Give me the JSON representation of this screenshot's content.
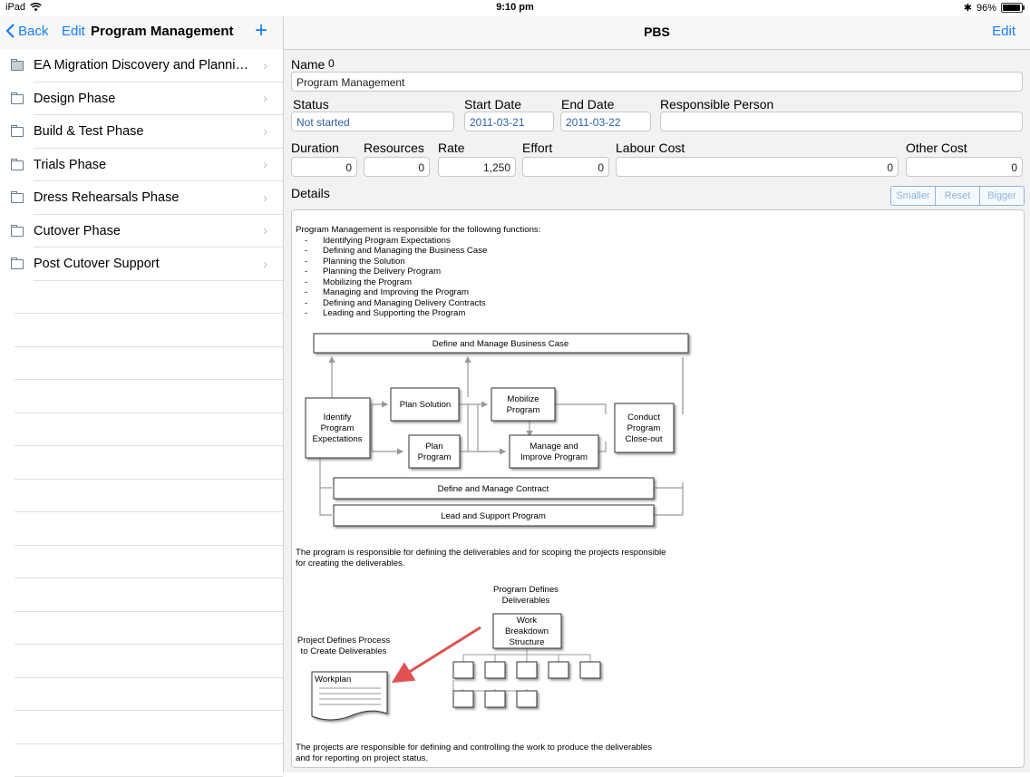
{
  "status_bar": {
    "device": "iPad",
    "time": "9:10 pm",
    "battery": "96%"
  },
  "sidebar": {
    "back_label": "Back",
    "edit_label": "Edit",
    "title": "Program Management",
    "add_label": "+",
    "items": [
      {
        "label": "EA Migration Discovery and Planning Phase",
        "icon": "folder-filled-icon"
      },
      {
        "label": "Design Phase",
        "icon": "folder-icon"
      },
      {
        "label": "Build & Test Phase",
        "icon": "folder-icon"
      },
      {
        "label": "Trials Phase",
        "icon": "folder-icon"
      },
      {
        "label": "Dress Rehearsals Phase",
        "icon": "folder-icon"
      },
      {
        "label": "Cutover Phase",
        "icon": "folder-icon"
      },
      {
        "label": "Post Cutover Support",
        "icon": "folder-icon"
      }
    ]
  },
  "main": {
    "title": "PBS",
    "edit_label": "Edit",
    "name_label": "Name",
    "name_count": "0",
    "name_value": "Program Management",
    "status_label": "Status",
    "status_value": "Not started",
    "start_label": "Start Date",
    "start_value": "2011-03-21",
    "end_label": "End Date",
    "end_value": "2011-03-22",
    "responsible_label": "Responsible Person",
    "responsible_value": "",
    "duration_label": "Duration",
    "duration_value": "0",
    "resources_label": "Resources",
    "resources_value": "0",
    "rate_label": "Rate",
    "rate_value": "1,250",
    "effort_label": "Effort",
    "effort_value": "0",
    "labour_label": "Labour Cost",
    "labour_value": "0",
    "other_label": "Other Cost",
    "other_value": "0",
    "details_label": "Details",
    "seg_smaller": "Smaller",
    "seg_reset": "Reset",
    "seg_bigger": "Bigger"
  },
  "details": {
    "intro": "Program Management is responsible for the following functions:",
    "functions": [
      "Identifying Program Expectations",
      "Defining and Managing the Business Case",
      "Planning the Solution",
      "Planning the Delivery Program",
      "Mobilizing the Program",
      "Managing and Improving the Program",
      "Defining and Managing Delivery Contracts",
      "Leading and Supporting the Program"
    ],
    "flow": {
      "business_case": "Define and Manage Business Case",
      "identify": [
        "Identify",
        "Program",
        "Expectations"
      ],
      "plan_solution": "Plan Solution",
      "plan_program": [
        "Plan",
        "Program"
      ],
      "mobilize": [
        "Mobilize",
        "Program"
      ],
      "manage_improve": [
        "Manage and",
        "Improve Program"
      ],
      "closeout": [
        "Conduct",
        "Program",
        "Close-out"
      ],
      "contract": "Define and Manage Contract",
      "lead_support": "Lead and Support Program"
    },
    "para2_line1": "The program is responsible for defining the deliverables and for scoping the projects responsible",
    "para2_line2": "for creating the deliverables.",
    "wbs": {
      "program_defines": [
        "Program Defines",
        "Deliverables"
      ],
      "wbs_box": [
        "Work",
        "Breakdown",
        "Structure"
      ],
      "project_defines": [
        "Project Defines Process",
        "to Create Deliverables"
      ],
      "workplan": "Workplan"
    },
    "para3_line1": "The projects are responsible for defining and controlling the work to produce the deliverables",
    "para3_line2": "and for reporting on project status."
  }
}
